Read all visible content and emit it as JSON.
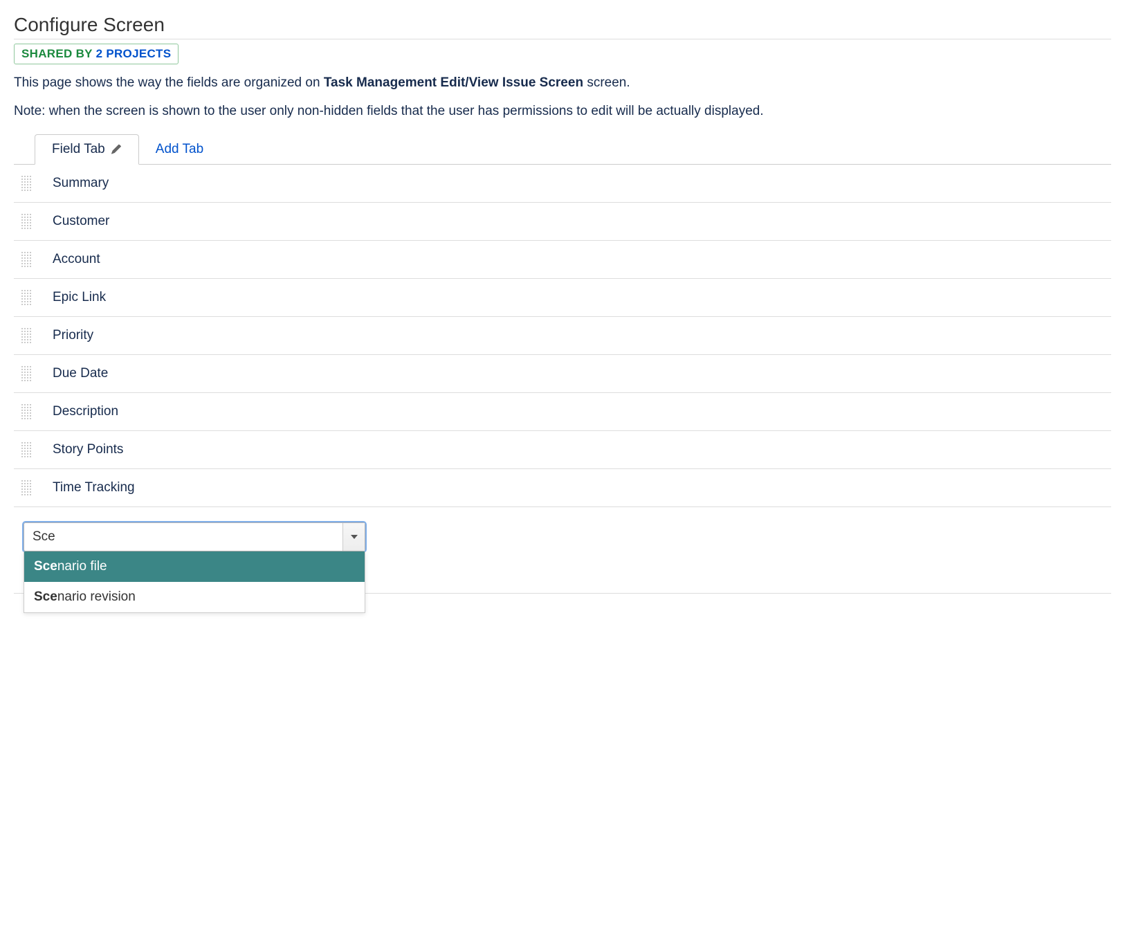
{
  "page": {
    "title": "Configure Screen",
    "shared_label": "SHARED BY",
    "shared_count": "2 PROJECTS",
    "desc_prefix": "This page shows the way the fields are organized on ",
    "screen_name": "Task Management Edit/View Issue Screen",
    "desc_suffix": " screen.",
    "note": "Note: when the screen is shown to the user only non-hidden fields that the user has permissions to edit will be actually displayed."
  },
  "tabs": {
    "active_label": "Field Tab",
    "add_label": "Add Tab"
  },
  "fields": [
    {
      "label": "Summary"
    },
    {
      "label": "Customer"
    },
    {
      "label": "Account"
    },
    {
      "label": "Epic Link"
    },
    {
      "label": "Priority"
    },
    {
      "label": "Due Date"
    },
    {
      "label": "Description"
    },
    {
      "label": "Story Points"
    },
    {
      "label": "Time Tracking"
    }
  ],
  "combobox": {
    "input_value": "Sce",
    "options": [
      {
        "match": "Sce",
        "rest": "nario file",
        "highlighted": true
      },
      {
        "match": "Sce",
        "rest": "nario revision",
        "highlighted": false
      }
    ]
  }
}
